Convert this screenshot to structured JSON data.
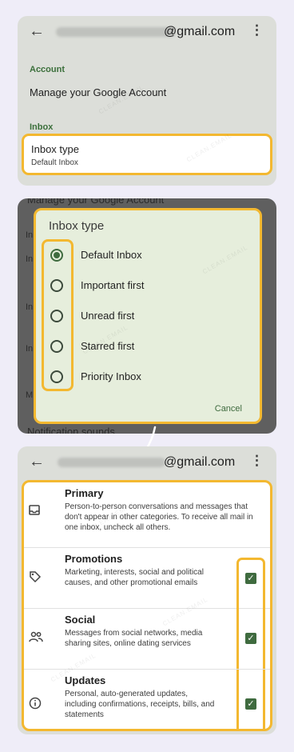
{
  "panel1": {
    "email_suffix": "@gmail.com",
    "account_section": "Account",
    "manage_account": "Manage your Google Account",
    "inbox_section": "Inbox",
    "inbox_type_title": "Inbox type",
    "inbox_type_value": "Default Inbox"
  },
  "panel2": {
    "bg_manage": "Manage your Google Account",
    "bg_notif": "Notification sounds",
    "dialog_title": "Inbox type",
    "options": [
      {
        "label": "Default Inbox",
        "selected": true
      },
      {
        "label": "Important first",
        "selected": false
      },
      {
        "label": "Unread first",
        "selected": false
      },
      {
        "label": "Starred first",
        "selected": false
      },
      {
        "label": "Priority Inbox",
        "selected": false
      }
    ],
    "cancel": "Cancel"
  },
  "panel3": {
    "email_suffix": "@gmail.com",
    "categories": [
      {
        "title": "Primary",
        "desc": "Person-to-person conversations and messages that don't appear in other categories. To receive all mail in one inbox, uncheck all others.",
        "icon": "inbox-icon",
        "checked": null
      },
      {
        "title": "Promotions",
        "desc": "Marketing, interests, social and political causes, and other promotional emails",
        "icon": "tag-icon",
        "checked": true
      },
      {
        "title": "Social",
        "desc": "Messages from social networks, media sharing sites, online dating services",
        "icon": "people-icon",
        "checked": true
      },
      {
        "title": "Updates",
        "desc": "Personal, auto-generated updates, including confirmations, receipts, bills, and statements",
        "icon": "info-icon",
        "checked": true
      }
    ]
  },
  "watermark": "CLEAN.EMAIL",
  "colors": {
    "highlight": "#f3b830",
    "accent": "#3f6b3f"
  }
}
